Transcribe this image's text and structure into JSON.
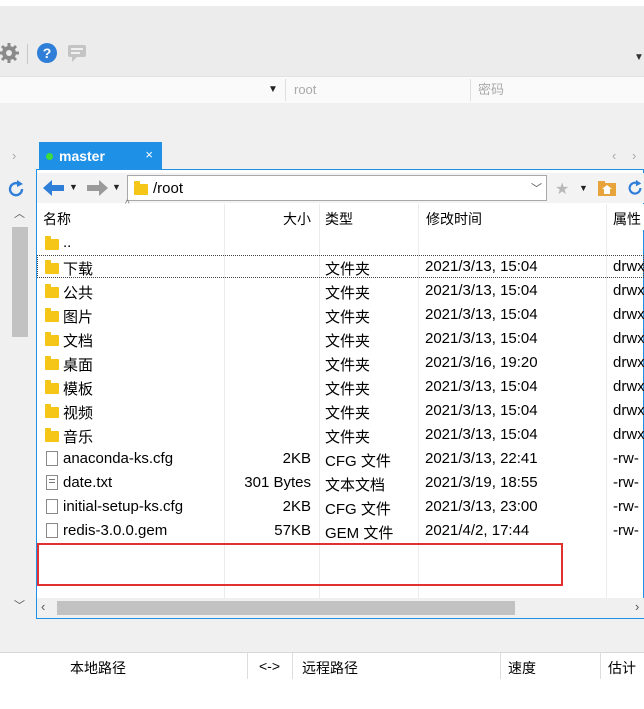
{
  "connection": {
    "root_value": "root",
    "password_placeholder": "密码",
    "dropdown_icon": "caret-down-icon"
  },
  "toolbar_icons": [
    "gear-icon",
    "help-icon",
    "chat-icon"
  ],
  "tab": {
    "label": "master",
    "close": "×",
    "status_color": "#3ddc3d"
  },
  "nav": {
    "path": "/root"
  },
  "columns": {
    "name": "名称",
    "size": "大小",
    "type": "类型",
    "modified": "修改时间",
    "attr": "属性"
  },
  "files": [
    {
      "name": "..",
      "size": "",
      "type": "",
      "modified": "",
      "attr": "",
      "icon": "folder"
    },
    {
      "name": "下载",
      "size": "",
      "type": "文件夹",
      "modified": "2021/3/13, 15:04",
      "attr": "drwx",
      "icon": "folder"
    },
    {
      "name": "公共",
      "size": "",
      "type": "文件夹",
      "modified": "2021/3/13, 15:04",
      "attr": "drwx",
      "icon": "folder"
    },
    {
      "name": "图片",
      "size": "",
      "type": "文件夹",
      "modified": "2021/3/13, 15:04",
      "attr": "drwx",
      "icon": "folder"
    },
    {
      "name": "文档",
      "size": "",
      "type": "文件夹",
      "modified": "2021/3/13, 15:04",
      "attr": "drwx",
      "icon": "folder"
    },
    {
      "name": "桌面",
      "size": "",
      "type": "文件夹",
      "modified": "2021/3/16, 19:20",
      "attr": "drwx",
      "icon": "folder"
    },
    {
      "name": "模板",
      "size": "",
      "type": "文件夹",
      "modified": "2021/3/13, 15:04",
      "attr": "drwx",
      "icon": "folder"
    },
    {
      "name": "视频",
      "size": "",
      "type": "文件夹",
      "modified": "2021/3/13, 15:04",
      "attr": "drwx",
      "icon": "folder"
    },
    {
      "name": "音乐",
      "size": "",
      "type": "文件夹",
      "modified": "2021/3/13, 15:04",
      "attr": "drwx",
      "icon": "folder"
    },
    {
      "name": "anaconda-ks.cfg",
      "size": "2KB",
      "type": "CFG 文件",
      "modified": "2021/3/13, 22:41",
      "attr": "-rw-",
      "icon": "file"
    },
    {
      "name": "date.txt",
      "size": "301 Bytes",
      "type": "文本文档",
      "modified": "2021/3/19, 18:55",
      "attr": "-rw-",
      "icon": "txt"
    },
    {
      "name": "initial-setup-ks.cfg",
      "size": "2KB",
      "type": "CFG 文件",
      "modified": "2021/3/13, 23:00",
      "attr": "-rw-",
      "icon": "file"
    },
    {
      "name": "redis-3.0.0.gem",
      "size": "57KB",
      "type": "GEM 文件",
      "modified": "2021/4/2, 17:44",
      "attr": "-rw-",
      "icon": "file"
    }
  ],
  "queue": {
    "local_path": "本地路径",
    "direction": "<->",
    "remote_path": "远程路径",
    "speed": "速度",
    "estimate": "估计剩"
  },
  "colors": {
    "accent": "#1e90e6",
    "highlight_box": "#e03030",
    "folder": "#f5c518"
  }
}
